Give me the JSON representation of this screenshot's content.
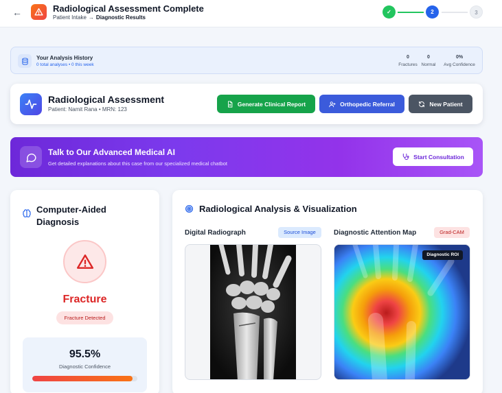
{
  "header": {
    "title": "Radiological Assessment Complete",
    "breadcrumb_prev": "Patient Intake",
    "breadcrumb_arrow": "→",
    "breadcrumb_current": "Diagnostic Results",
    "steps": [
      {
        "label": "✓",
        "state": "done"
      },
      {
        "label": "2",
        "state": "active"
      },
      {
        "label": "3",
        "state": "todo"
      }
    ]
  },
  "history": {
    "title": "Your Analysis History",
    "subtitle": "0 total analyses • 0 this week",
    "stats": [
      {
        "value": "0",
        "label": "Fractures"
      },
      {
        "value": "0",
        "label": "Normal"
      },
      {
        "value": "0%",
        "label": "Avg Confidence"
      }
    ]
  },
  "assessment": {
    "title": "Radiological Assessment",
    "patient_line": "Patient: Namit Rana • MRN: 123",
    "buttons": {
      "report": "Generate Clinical Report",
      "referral": "Orthopedic Referral",
      "new_patient": "New Patient"
    }
  },
  "ai_banner": {
    "title": "Talk to Our Advanced Medical AI",
    "subtitle": "Get detailed explanations about this case from our specialized medical chatbot",
    "button": "Start Consultation"
  },
  "cad": {
    "title": "Computer-Aided Diagnosis",
    "result": "Fracture",
    "badge": "Fracture Detected",
    "confidence_value": "95.5%",
    "confidence_label": "Diagnostic Confidence",
    "confidence_fraction": 0.955
  },
  "viz": {
    "title": "Radiological Analysis & Visualization",
    "left_panel": {
      "title": "Digital Radiograph",
      "tag": "Source Image"
    },
    "right_panel": {
      "title": "Diagnostic Attention Map",
      "tag": "Grad-CAM",
      "roi_label": "Diagnostic ROI"
    }
  },
  "colors": {
    "primary_blue": "#2563eb",
    "success_green": "#16a34a",
    "danger_red": "#dc2626",
    "ai_purple": "#7c3aed"
  }
}
